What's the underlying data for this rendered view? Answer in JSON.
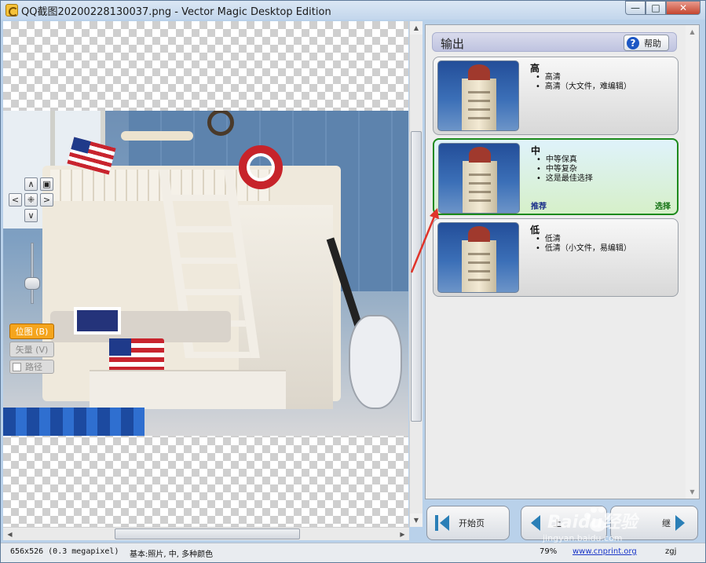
{
  "window": {
    "title": "QQ截图20200228130037.png - Vector Magic Desktop Edition",
    "min_label": "—",
    "max_label": "□",
    "close_label": "✕"
  },
  "left": {
    "nav": {
      "up": "∧",
      "down": "∨",
      "left": "<",
      "right": ">",
      "center": "⁜",
      "fit": "▣"
    },
    "modes": {
      "bitmap": "位图 (B)",
      "vector": "矢量 (V)",
      "path": "路径"
    }
  },
  "right": {
    "header_title": "输出",
    "help_label": "帮助",
    "help_icon": "?",
    "cards": [
      {
        "id": "high",
        "title": "高",
        "bullets": [
          "高清",
          "高清（大文件，难编辑）"
        ],
        "footer_left": "",
        "footer_right": ""
      },
      {
        "id": "mid",
        "title": "中",
        "bullets": [
          "中等保真",
          "中等复杂",
          "这是最佳选择"
        ],
        "footer_left": "推荐",
        "footer_right": "选择"
      },
      {
        "id": "low",
        "title": "低",
        "bullets": [
          "低清",
          "低清（小文件，易编辑）"
        ],
        "footer_left": "",
        "footer_right": ""
      }
    ]
  },
  "bottom": {
    "start_label": "开始页",
    "prev_label": "上",
    "next_label": "继"
  },
  "status": {
    "dims": "656x526 (0.3 megapixel)",
    "info": "基本:照片, 中, 多种颜色",
    "zoom": "79%",
    "link": "www.cnprint.org",
    "user": "zgj"
  },
  "watermark": {
    "brand": "Baidu经验",
    "sub": "jingyan.baidu.com"
  },
  "colors": {
    "accent_orange": "#f5a51d",
    "selected_green": "#1c8a1c",
    "header_lavender": "#bfc3e0",
    "link_blue": "#1a36c8"
  }
}
